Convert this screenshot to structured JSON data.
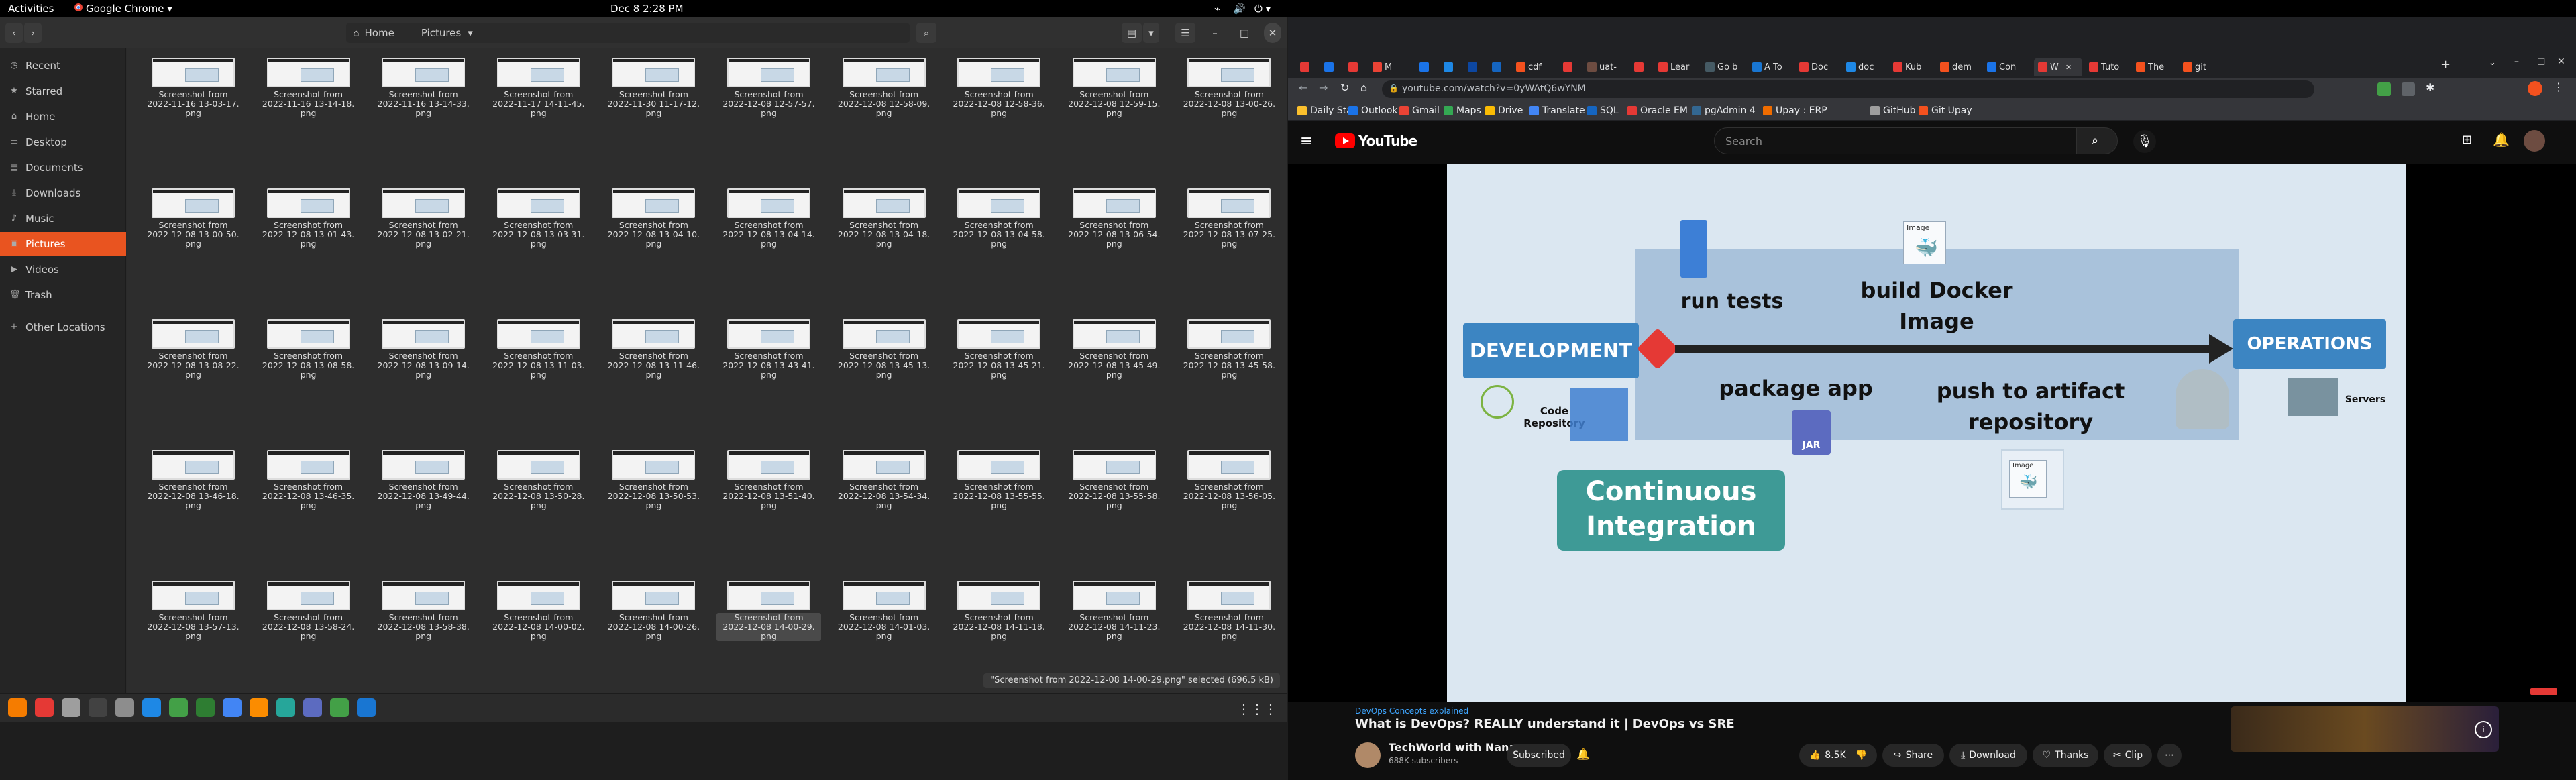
{
  "topbar": {
    "activities": "Activities",
    "app_menu": "Google Chrome ▾",
    "clock": "Dec 8  2:28 PM"
  },
  "files": {
    "path_home": "Home",
    "path_current": "Pictures",
    "sidebar": [
      {
        "label": "Recent",
        "icon": "clock"
      },
      {
        "label": "Starred",
        "icon": "star"
      },
      {
        "label": "Home",
        "icon": "home"
      },
      {
        "label": "Desktop",
        "icon": "desktop"
      },
      {
        "label": "Documents",
        "icon": "document"
      },
      {
        "label": "Downloads",
        "icon": "download"
      },
      {
        "label": "Music",
        "icon": "music"
      },
      {
        "label": "Pictures",
        "icon": "picture",
        "active": true
      },
      {
        "label": "Videos",
        "icon": "video"
      },
      {
        "label": "Trash",
        "icon": "trash"
      },
      {
        "label": "Other Locations",
        "icon": "plus"
      }
    ],
    "items": [
      {
        "line1": "Screenshot from",
        "line2": "2022-11-16 13-03-17.",
        "line3": "png"
      },
      {
        "line1": "Screenshot from",
        "line2": "2022-11-16 13-14-18.",
        "line3": "png"
      },
      {
        "line1": "Screenshot from",
        "line2": "2022-11-16 13-14-33.",
        "line3": "png"
      },
      {
        "line1": "Screenshot from",
        "line2": "2022-11-17 14-11-45.",
        "line3": "png"
      },
      {
        "line1": "Screenshot from",
        "line2": "2022-11-30 11-17-12.",
        "line3": "png"
      },
      {
        "line1": "Screenshot from",
        "line2": "2022-12-08 12-57-57.",
        "line3": "png"
      },
      {
        "line1": "Screenshot from",
        "line2": "2022-12-08 12-58-09.",
        "line3": "png"
      },
      {
        "line1": "Screenshot from",
        "line2": "2022-12-08 12-58-36.",
        "line3": "png"
      },
      {
        "line1": "Screenshot from",
        "line2": "2022-12-08 12-59-15.",
        "line3": "png"
      },
      {
        "line1": "Screenshot from",
        "line2": "2022-12-08 13-00-26.",
        "line3": "png"
      },
      {
        "line1": "Screenshot from",
        "line2": "2022-12-08 13-00-50.",
        "line3": "png"
      },
      {
        "line1": "Screenshot from",
        "line2": "2022-12-08 13-01-43.",
        "line3": "png"
      },
      {
        "line1": "Screenshot from",
        "line2": "2022-12-08 13-02-21.",
        "line3": "png"
      },
      {
        "line1": "Screenshot from",
        "line2": "2022-12-08 13-03-31.",
        "line3": "png"
      },
      {
        "line1": "Screenshot from",
        "line2": "2022-12-08 13-04-10.",
        "line3": "png"
      },
      {
        "line1": "Screenshot from",
        "line2": "2022-12-08 13-04-14.",
        "line3": "png"
      },
      {
        "line1": "Screenshot from",
        "line2": "2022-12-08 13-04-18.",
        "line3": "png"
      },
      {
        "line1": "Screenshot from",
        "line2": "2022-12-08 13-04-58.",
        "line3": "png"
      },
      {
        "line1": "Screenshot from",
        "line2": "2022-12-08 13-06-54.",
        "line3": "png"
      },
      {
        "line1": "Screenshot from",
        "line2": "2022-12-08 13-07-25.",
        "line3": "png"
      },
      {
        "line1": "Screenshot from",
        "line2": "2022-12-08 13-08-22.",
        "line3": "png"
      },
      {
        "line1": "Screenshot from",
        "line2": "2022-12-08 13-08-58.",
        "line3": "png"
      },
      {
        "line1": "Screenshot from",
        "line2": "2022-12-08 13-09-14.",
        "line3": "png"
      },
      {
        "line1": "Screenshot from",
        "line2": "2022-12-08 13-11-03.",
        "line3": "png"
      },
      {
        "line1": "Screenshot from",
        "line2": "2022-12-08 13-11-46.",
        "line3": "png"
      },
      {
        "line1": "Screenshot from",
        "line2": "2022-12-08 13-43-41.",
        "line3": "png"
      },
      {
        "line1": "Screenshot from",
        "line2": "2022-12-08 13-45-13.",
        "line3": "png"
      },
      {
        "line1": "Screenshot from",
        "line2": "2022-12-08 13-45-21.",
        "line3": "png"
      },
      {
        "line1": "Screenshot from",
        "line2": "2022-12-08 13-45-49.",
        "line3": "png"
      },
      {
        "line1": "Screenshot from",
        "line2": "2022-12-08 13-45-58.",
        "line3": "png"
      },
      {
        "line1": "Screenshot from",
        "line2": "2022-12-08 13-46-18.",
        "line3": "png"
      },
      {
        "line1": "Screenshot from",
        "line2": "2022-12-08 13-46-35.",
        "line3": "png"
      },
      {
        "line1": "Screenshot from",
        "line2": "2022-12-08 13-49-44.",
        "line3": "png"
      },
      {
        "line1": "Screenshot from",
        "line2": "2022-12-08 13-50-28.",
        "line3": "png"
      },
      {
        "line1": "Screenshot from",
        "line2": "2022-12-08 13-50-53.",
        "line3": "png"
      },
      {
        "line1": "Screenshot from",
        "line2": "2022-12-08 13-51-40.",
        "line3": "png"
      },
      {
        "line1": "Screenshot from",
        "line2": "2022-12-08 13-54-34.",
        "line3": "png"
      },
      {
        "line1": "Screenshot from",
        "line2": "2022-12-08 13-55-55.",
        "line3": "png"
      },
      {
        "line1": "Screenshot from",
        "line2": "2022-12-08 13-55-58.",
        "line3": "png"
      },
      {
        "line1": "Screenshot from",
        "line2": "2022-12-08 13-56-05.",
        "line3": "png"
      },
      {
        "line1": "Screenshot from",
        "line2": "2022-12-08 13-57-13.",
        "line3": "png"
      },
      {
        "line1": "Screenshot from",
        "line2": "2022-12-08 13-58-24.",
        "line3": "png"
      },
      {
        "line1": "Screenshot from",
        "line2": "2022-12-08 13-58-38.",
        "line3": "png"
      },
      {
        "line1": "Screenshot from",
        "line2": "2022-12-08 14-00-02.",
        "line3": "png"
      },
      {
        "line1": "Screenshot from",
        "line2": "2022-12-08 14-00-26.",
        "line3": "png"
      },
      {
        "line1": "Screenshot from",
        "line2": "2022-12-08 14-00-29.",
        "line3": "png",
        "selected": true
      },
      {
        "line1": "Screenshot from",
        "line2": "2022-12-08 14-01-03.",
        "line3": "png"
      },
      {
        "line1": "Screenshot from",
        "line2": "2022-12-08 14-11-18.",
        "line3": "png"
      },
      {
        "line1": "Screenshot from",
        "line2": "2022-12-08 14-11-23.",
        "line3": "png"
      },
      {
        "line1": "Screenshot from",
        "line2": "2022-12-08 14-11-30.",
        "line3": "png"
      }
    ],
    "status": "\"Screenshot from 2022-12-08 14-00-29.png\" selected (696.5 kB)"
  },
  "chrome": {
    "tabs": [
      {
        "label": "",
        "color": "#e53935"
      },
      {
        "label": "",
        "color": "#1a73e8"
      },
      {
        "label": "",
        "color": "#e53935"
      },
      {
        "label": "M",
        "color": "#ea4335"
      },
      {
        "label": "",
        "color": "#1a73e8"
      },
      {
        "label": "",
        "color": "#1e88e5"
      },
      {
        "label": "",
        "color": "#0d47a1"
      },
      {
        "label": "",
        "color": "#1565c0"
      },
      {
        "label": "cdf",
        "color": "#f4511e"
      },
      {
        "label": "",
        "color": "#e53935"
      },
      {
        "label": "uat-",
        "color": "#6d4c41"
      },
      {
        "label": "",
        "color": "#e53935"
      },
      {
        "label": "Lear",
        "color": "#e53935"
      },
      {
        "label": "Go b",
        "color": "#455a64"
      },
      {
        "label": "A To",
        "color": "#1976d2"
      },
      {
        "label": "Doc",
        "color": "#e53935"
      },
      {
        "label": "doc",
        "color": "#1e88e5"
      },
      {
        "label": "Kub",
        "color": "#e53935"
      },
      {
        "label": "dem",
        "color": "#f4511e"
      },
      {
        "label": "Con",
        "color": "#1a73e8"
      },
      {
        "label": "W",
        "color": "#e53935",
        "active": true
      },
      {
        "label": "Tuto",
        "color": "#e53935"
      },
      {
        "label": "The",
        "color": "#f4511e"
      },
      {
        "label": "git",
        "color": "#f4511e"
      }
    ],
    "url": "youtube.com/watch?v=0yWAtQ6wYNM",
    "bookmarks": [
      {
        "label": "Daily Star",
        "color": "#fbc02d"
      },
      {
        "label": "Outlook",
        "color": "#1a73e8"
      },
      {
        "label": "Gmail",
        "color": "#ea4335"
      },
      {
        "label": "Maps",
        "color": "#34a853"
      },
      {
        "label": "Drive",
        "color": "#fbbc04"
      },
      {
        "label": "Translate",
        "color": "#4285f4"
      },
      {
        "label": "SQL",
        "color": "#1565c0"
      },
      {
        "label": "Oracle EM",
        "color": "#e53935"
      },
      {
        "label": "pgAdmin 4",
        "color": "#336791"
      },
      {
        "label": "Upay : ERP",
        "color": "#ef6c00"
      },
      {
        "label": "GitHub",
        "color": "#9e9e9e"
      },
      {
        "label": "Git Upay",
        "color": "#f4511e"
      }
    ]
  },
  "youtube": {
    "logo": "YouTube",
    "search_placeholder": "Search",
    "slide": {
      "development": "DEVELOPMENT",
      "operations": "OPERATIONS",
      "run_tests": "run tests",
      "build_docker_1": "build Docker",
      "build_docker_2": "Image",
      "package_app": "package app",
      "push_1": "push to artifact",
      "push_2": "repository",
      "code_1": "Code",
      "code_2": "Repository",
      "servers": "Servers",
      "image_label": "Image",
      "jar": "JAR",
      "ci_1": "Continuous",
      "ci_2": "Integration"
    },
    "video": {
      "category": "DevOps Concepts explained",
      "title": "What is DevOps? REALLY understand it | DevOps vs SRE",
      "channel": "TechWorld with Nana",
      "subscribers": "688K subscribers",
      "subscribed": "Subscribed",
      "likes": "8.5K",
      "share": "Share",
      "download": "Download",
      "thanks": "Thanks",
      "clip": "Clip"
    }
  },
  "dock_colors": [
    "#f57c00",
    "#e53935",
    "#9e9e9e",
    "#424242",
    "#8d8d8d",
    "#1e88e5",
    "#43a047",
    "#2e7d32",
    "#4285f4",
    "#fb8c00",
    "#26a69a",
    "#5c6bc0",
    "#43a047",
    "#1976d2"
  ]
}
